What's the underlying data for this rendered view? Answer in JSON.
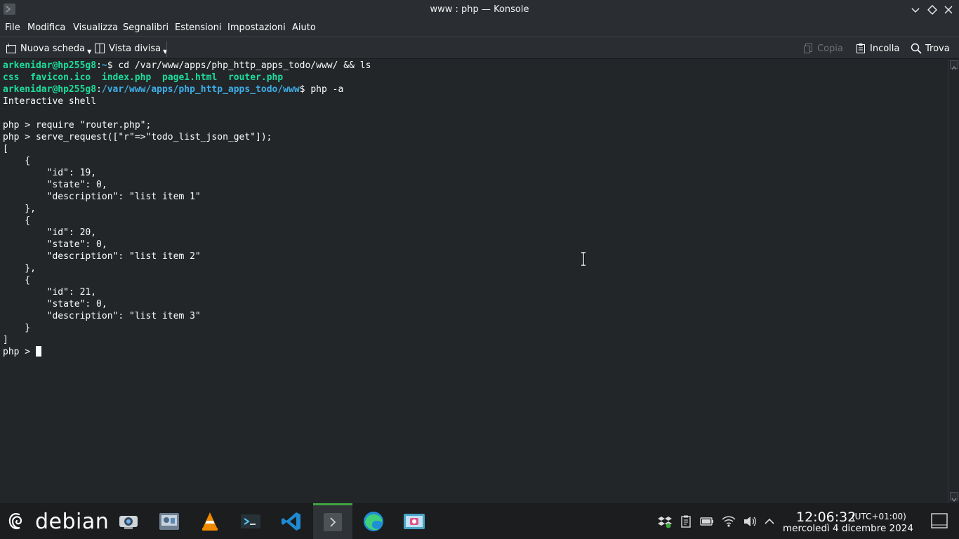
{
  "window": {
    "title": "www : php — Konsole"
  },
  "menu": [
    "File",
    "Modifica",
    "Visualizza",
    "Segnalibri",
    "Estensioni",
    "Impostazioni",
    "Aiuto"
  ],
  "toolbar": {
    "new_tab": "Nuova scheda",
    "split_view": "Vista divisa",
    "copy": "Copia",
    "paste": "Incolla",
    "find": "Trova"
  },
  "terminal": {
    "prompt1": {
      "user": "arkenidar@hp255g8",
      "sep": ":",
      "path": "~",
      "dollar": "$ ",
      "cmd": "cd /var/www/apps/php_http_apps_todo/www/ && ls"
    },
    "ls_output": [
      "css",
      "favicon.ico",
      "index.php",
      "page1.html",
      "router.php"
    ],
    "prompt2": {
      "user": "arkenidar@hp255g8",
      "sep": ":",
      "path": "/var/www/apps/php_http_apps_todo/www",
      "dollar": "$ ",
      "cmd": "php -a"
    },
    "lines": [
      "Interactive shell",
      "",
      "php > require \"router.php\";",
      "php > serve_request([\"r\"=>\"todo_list_json_get\"]);",
      "[",
      "    {",
      "        \"id\": 19,",
      "        \"state\": 0,",
      "        \"description\": \"list item 1\"",
      "    },",
      "    {",
      "        \"id\": 20,",
      "        \"state\": 0,",
      "        \"description\": \"list item 2\"",
      "    },",
      "    {",
      "        \"id\": 21,",
      "        \"state\": 0,",
      "        \"description\": \"list item 3\"",
      "    }",
      "]"
    ],
    "last_prompt": "php > "
  },
  "taskbar": {
    "launcher_label": "debian",
    "apps": [
      "webcam-app-icon",
      "media-app-icon",
      "vlc-icon",
      "terminal-app-icon",
      "vscode-icon",
      "konsole-icon",
      "edge-icon",
      "screenshot-app-icon"
    ],
    "active_app": "konsole-icon",
    "clock_time": "12:06:32",
    "clock_tz": "(UTC+01:00)",
    "clock_date": "mercoledì 4 dicembre 2024"
  },
  "colors": {
    "user": "#1cdc9a",
    "path": "#3daee9",
    "text": "#fcfcfc",
    "background": "#232629",
    "active_task": "#3ea53e"
  }
}
